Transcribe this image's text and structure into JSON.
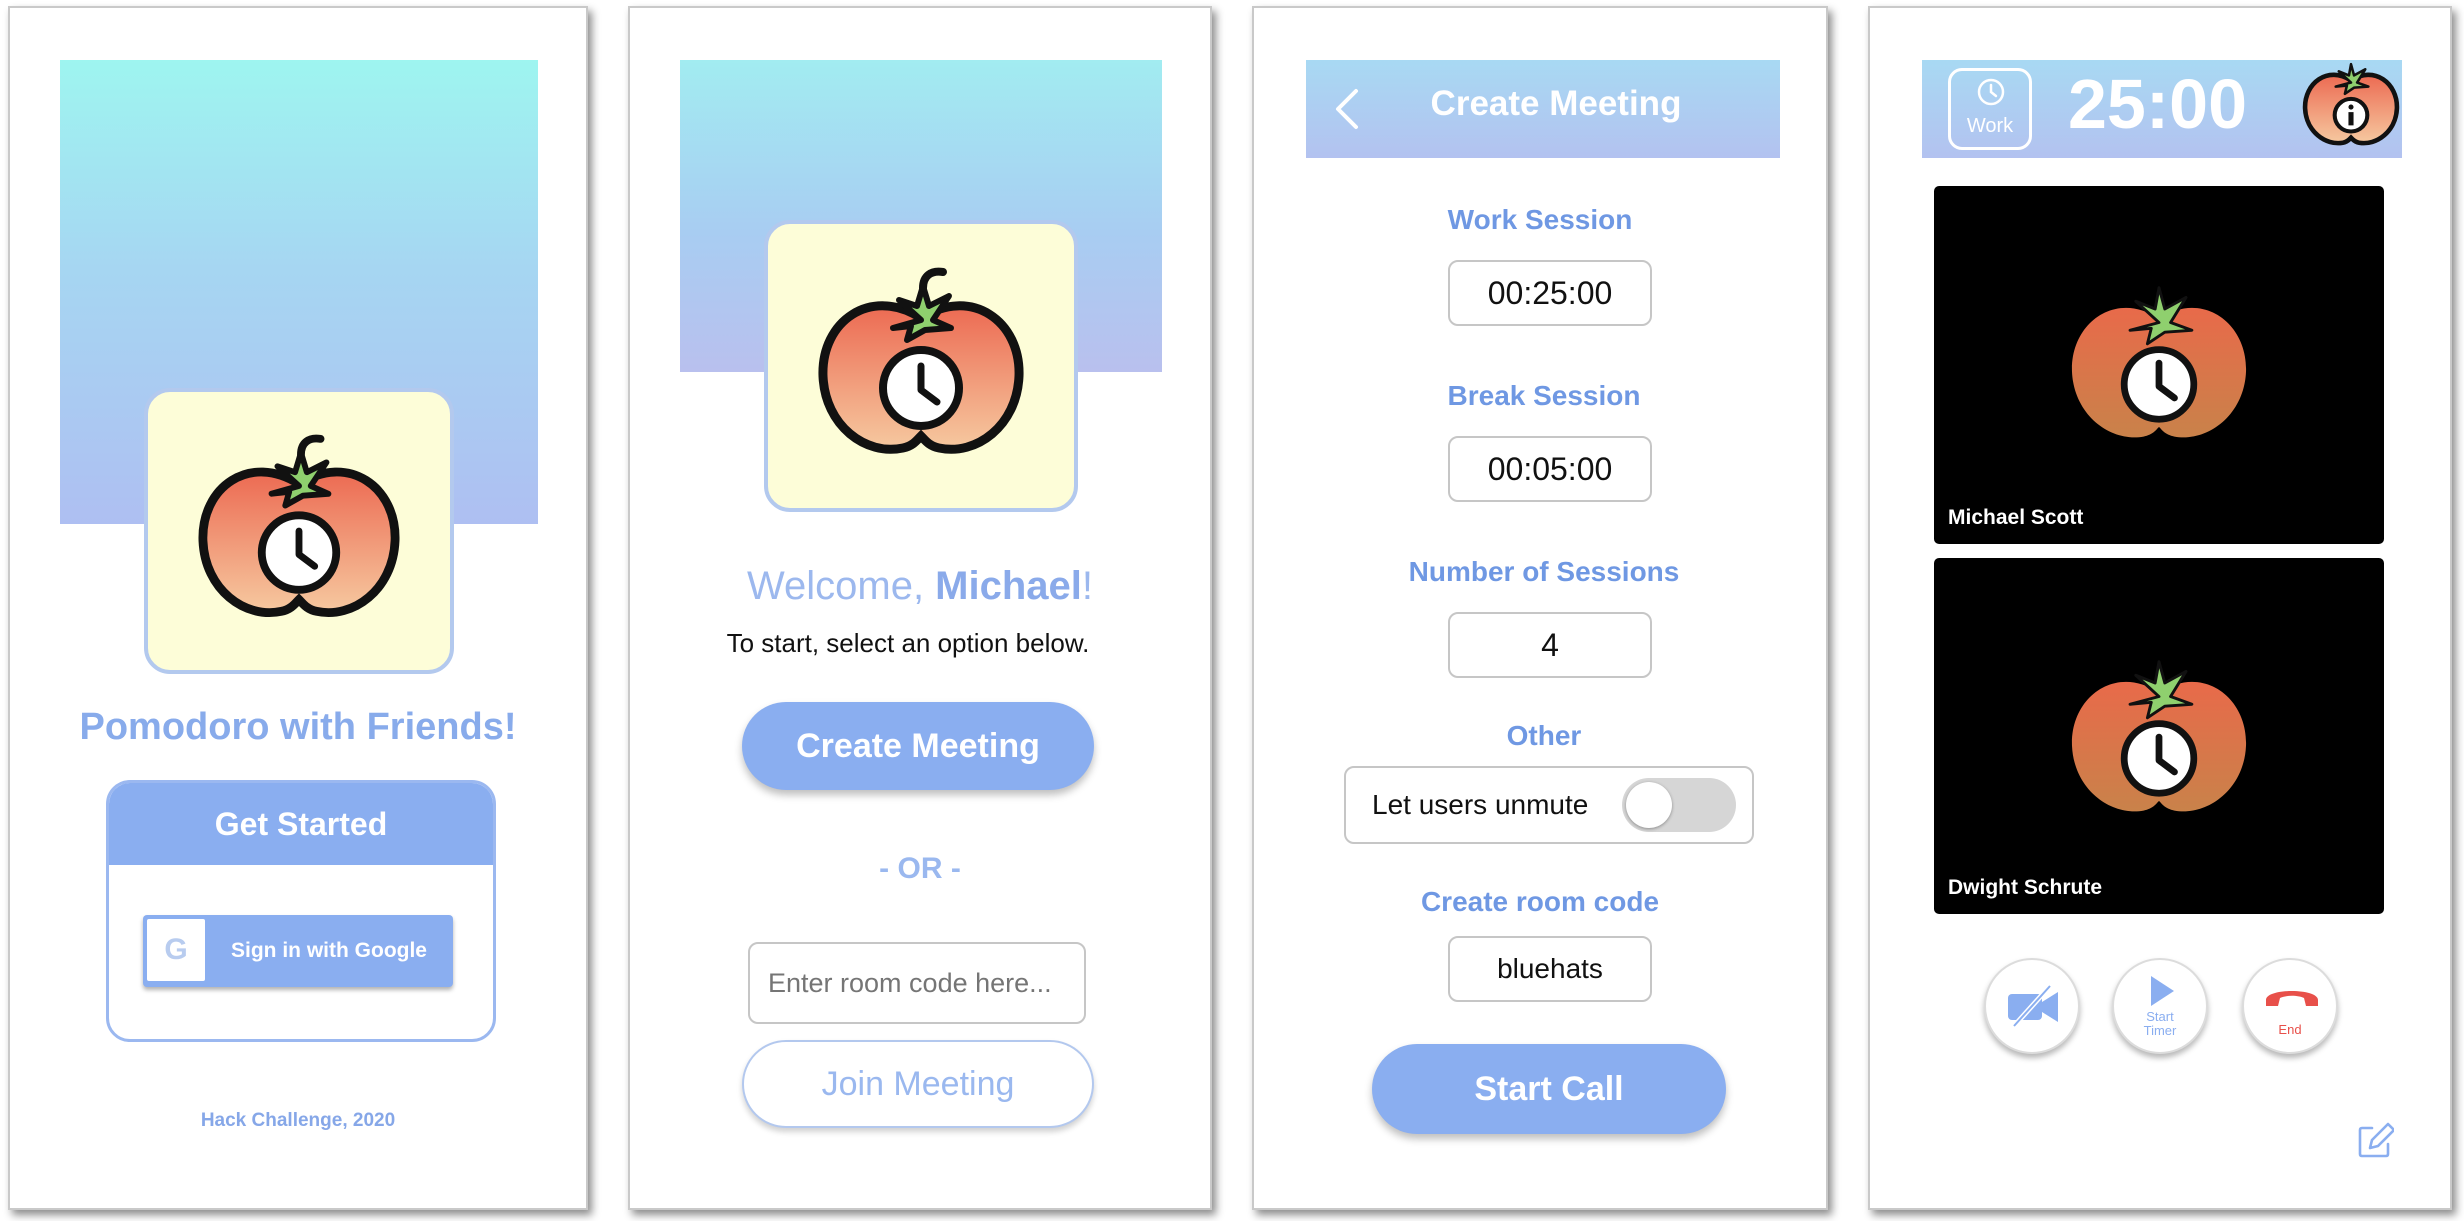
{
  "colors": {
    "accent": "#8aaef0",
    "label_blue": "#6f98e3",
    "end_red": "#e8504a",
    "logo_bg": "#fdfdd8"
  },
  "screen1": {
    "app_title": "Pomodoro with Friends!",
    "get_started_label": "Get Started",
    "google_letter": "G",
    "google_label": "Sign in with Google",
    "footer": "Hack Challenge, 2020"
  },
  "screen2": {
    "welcome_prefix": "Welcome, ",
    "welcome_name": "Michael",
    "welcome_suffix": "!",
    "subtitle": "To start, select an option below.",
    "create_meeting_label": "Create Meeting",
    "or_label": "- OR -",
    "room_code_placeholder": "Enter room code here...",
    "join_meeting_label": "Join Meeting"
  },
  "screen3": {
    "header_title": "Create Meeting",
    "back_icon": "chevron-left-icon",
    "work_session_label": "Work Session",
    "work_session_value": "00:25:00",
    "break_session_label": "Break Session",
    "break_session_value": "00:05:00",
    "num_sessions_label": "Number of Sessions",
    "num_sessions_value": "4",
    "other_label": "Other",
    "unmute_label": "Let users unmute",
    "unmute_enabled": false,
    "room_code_label": "Create room code",
    "room_code_value": "bluehats",
    "start_call_label": "Start Call"
  },
  "screen4": {
    "mode_label": "Work",
    "timer": "25:00",
    "participants": [
      {
        "name": "Michael Scott"
      },
      {
        "name": "Dwight Schrute"
      }
    ],
    "start_timer_label": "Start Timer",
    "end_label": "End"
  }
}
